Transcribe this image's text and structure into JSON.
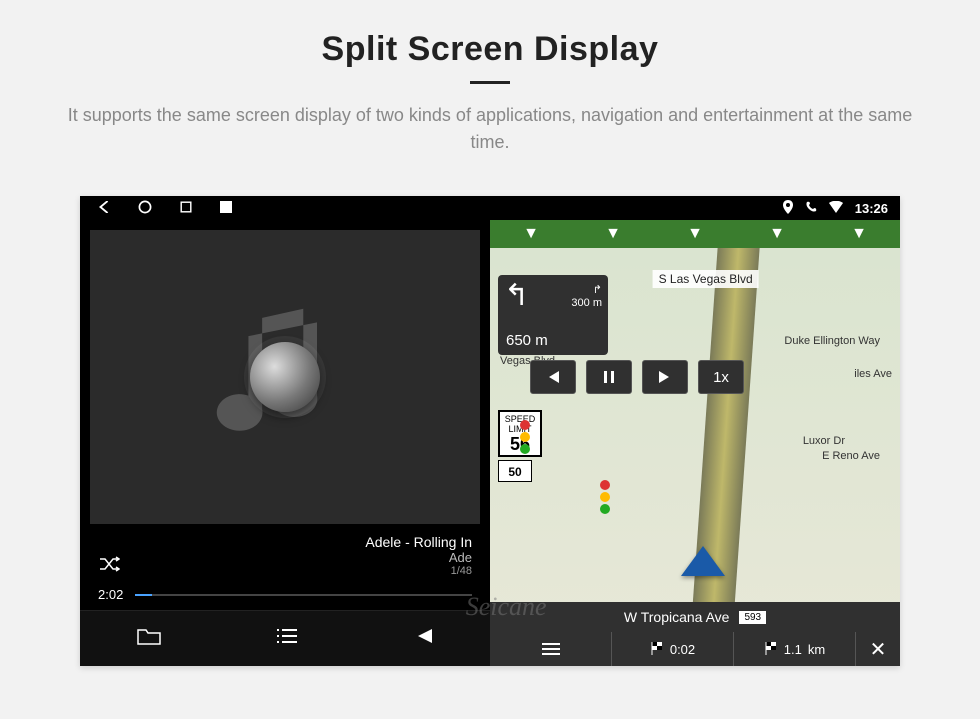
{
  "header": {
    "title": "Split Screen Display",
    "subtitle": "It supports the same screen display of two kinds of applications, navigation and entertainment at the same time."
  },
  "sysbar": {
    "time": "13:26"
  },
  "music": {
    "song": "Adele - Rolling In",
    "artist": "Ade",
    "index": "1/48",
    "elapsed": "2:02"
  },
  "nav": {
    "street_top": "S Las Vegas Blvd",
    "street_right1": "Duke Ellington Way",
    "street_left1": "Vegas Blvd",
    "street_right2": "E Reno Ave",
    "street_right3": "Luxor Dr",
    "turn": {
      "next_dist": "300",
      "next_unit": "m",
      "main_dist": "650",
      "main_unit": "m"
    },
    "speed_limit_label": "SPEED LIMIT",
    "speed_limit": "56",
    "route": "50",
    "speedbtn": "1x",
    "current_street": "W Tropicana Ave",
    "current_tag": "593",
    "bottom": {
      "time": "0:02",
      "km": "1.1",
      "km_unit": "km"
    },
    "iles": "iles Ave"
  },
  "watermark": "Seicane"
}
